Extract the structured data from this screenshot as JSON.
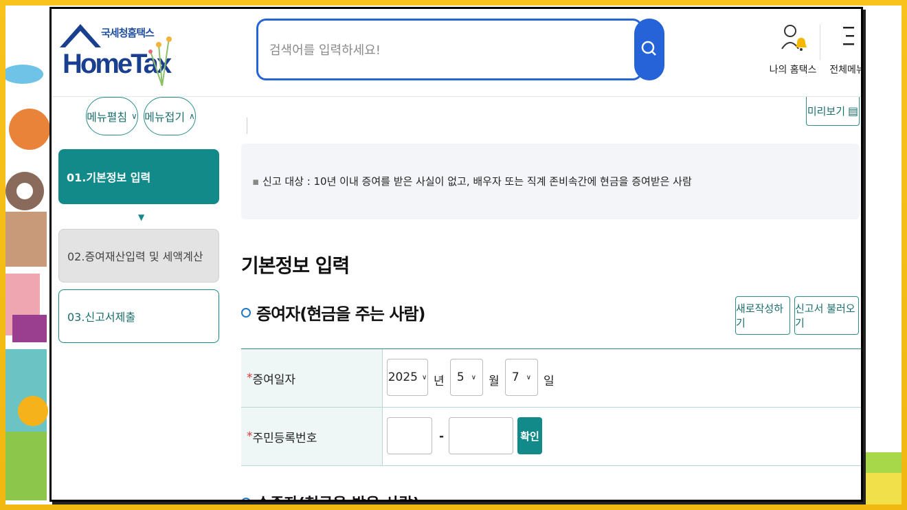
{
  "header": {
    "logo_kr": "국세청홈택스",
    "logo_en": "HomeTax",
    "search_placeholder": "검색어를 입력하세요!",
    "my_hometax": "나의 홈택스",
    "all_menu": "전체메뉴"
  },
  "sidebar": {
    "expand": "메뉴펼침",
    "collapse": "메뉴접기",
    "steps": [
      "01.기본정보 입력",
      "02.증여재산입력 및 세액계산",
      "03.신고서제출"
    ]
  },
  "main": {
    "preview": "미리보기",
    "notice": "신고 대상 : 10년 이내 증여를 받은 사실이 없고, 배우자 또는 직계 존비속간에 현금을 증여받은 사람",
    "section_title": "기본정보 입력",
    "donor_title": "증여자(현금을 주는 사람)",
    "new_write": "새로작성하기",
    "load_report": "신고서 불러오기",
    "date_label": "증여일자",
    "year": "2025",
    "year_unit": "년",
    "month": "5",
    "month_unit": "월",
    "day": "7",
    "day_unit": "일",
    "id_label": "주민등록번호",
    "dash": "-",
    "confirm": "확인",
    "recipient_title": "수증자(현금을 받은 사람)"
  },
  "colors": {
    "teal": "#138a8a",
    "blue": "#2563d8",
    "frame": "#f3c21a"
  }
}
